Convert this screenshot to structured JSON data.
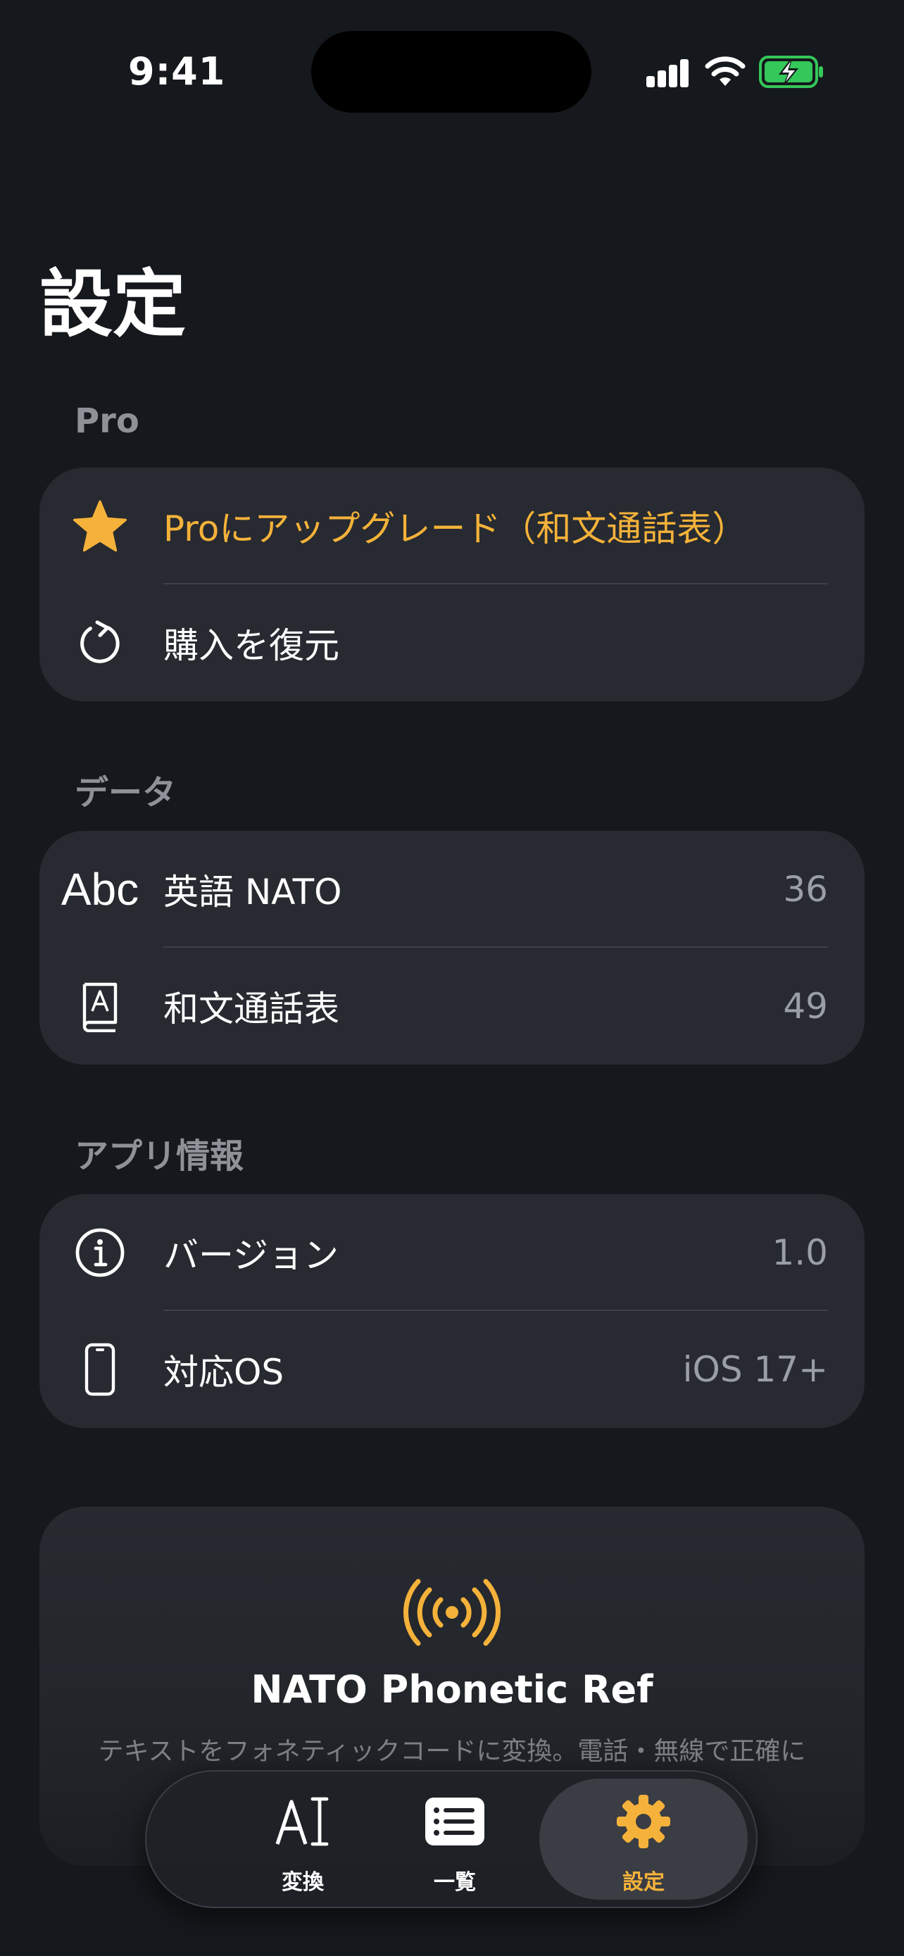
{
  "status_bar": {
    "time": "9:41"
  },
  "page_title": "設定",
  "sections": {
    "pro": {
      "header": "Pro",
      "upgrade_label": "Proにアップグレード（和文通話表）",
      "restore_label": "購入を復元"
    },
    "data": {
      "header": "データ",
      "rows": [
        {
          "icon_text": "Abc",
          "label": "英語 NATO",
          "value": "36"
        },
        {
          "label": "和文通話表",
          "value": "49"
        }
      ]
    },
    "app_info": {
      "header": "アプリ情報",
      "rows": [
        {
          "label": "バージョン",
          "value": "1.0"
        },
        {
          "label": "対応OS",
          "value": "iOS 17+"
        }
      ]
    }
  },
  "promo": {
    "title": "NATO Phonetic Ref",
    "description": "テキストをフォネティックコードに変換。電話・無線で正確に"
  },
  "tab_bar": {
    "tabs": [
      {
        "label": "変換",
        "icon": "text-cursor-icon"
      },
      {
        "label": "一覧",
        "icon": "list-icon"
      },
      {
        "label": "設定",
        "icon": "gear-icon"
      }
    ],
    "active": "設定"
  },
  "colors": {
    "accent": "#f5b23a",
    "background": "#15181c",
    "card": "#272a30",
    "battery_green": "#34c759"
  }
}
